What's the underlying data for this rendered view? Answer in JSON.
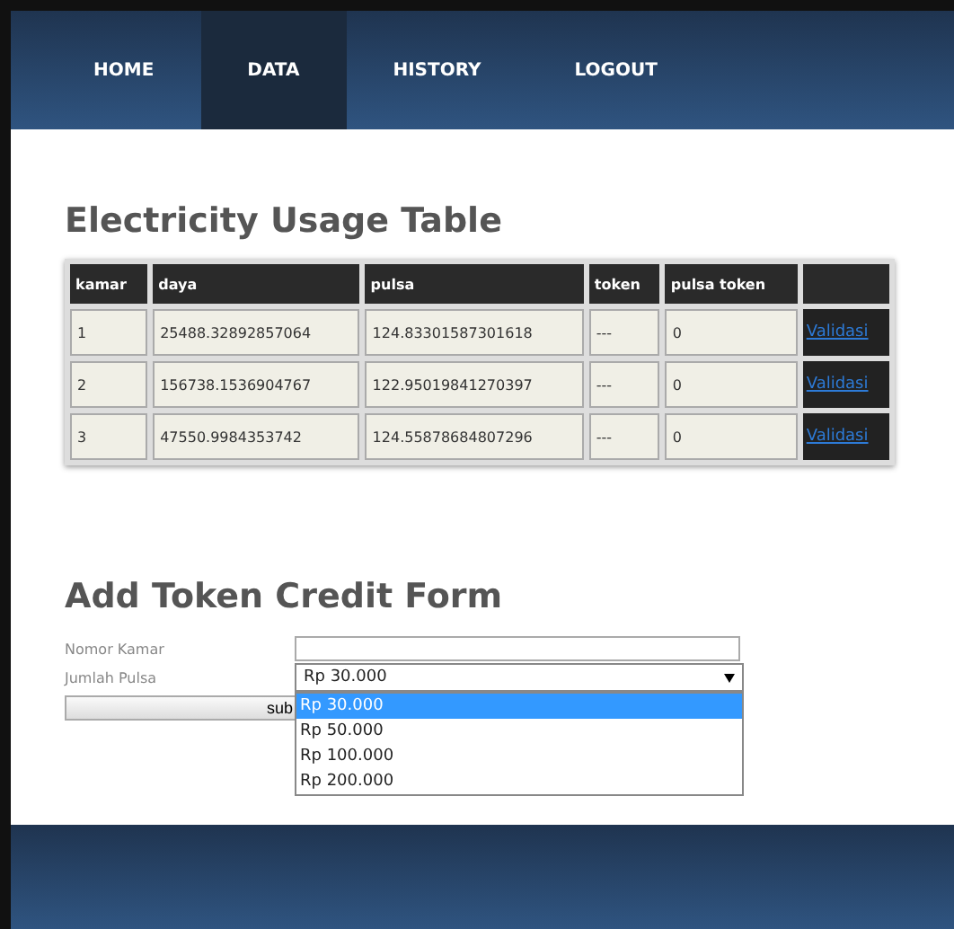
{
  "nav": [
    {
      "label": "HOME",
      "selected": false
    },
    {
      "label": "DATA",
      "selected": true
    },
    {
      "label": "HISTORY",
      "selected": false
    },
    {
      "label": "LOGOUT",
      "selected": false
    }
  ],
  "table": {
    "title": "Electricity Usage Table",
    "columns": [
      "kamar",
      "daya",
      "pulsa",
      "token",
      "pulsa token",
      ""
    ],
    "rows": [
      {
        "cells": [
          "1",
          "25488.32892857064",
          "124.83301587301618",
          "---",
          "0"
        ],
        "action": "Validasi"
      },
      {
        "cells": [
          "2",
          "156738.1536904767",
          "122.95019841270397",
          "---",
          "0"
        ],
        "action": "Validasi"
      },
      {
        "cells": [
          "3",
          "47550.9984353742",
          "124.55878684807296",
          "---",
          "0"
        ],
        "action": "Validasi"
      }
    ]
  },
  "form": {
    "title": "Add Token Credit Form",
    "nomor_label": "Nomor Kamar",
    "jumlah_label": "Jumlah Pulsa",
    "select_value": "Rp 30.000",
    "submit": "sub",
    "options": [
      {
        "label": "Rp 30.000",
        "selected": true
      },
      {
        "label": "Rp 50.000",
        "selected": false
      },
      {
        "label": "Rp 100.000",
        "selected": false
      },
      {
        "label": "Rp 200.000",
        "selected": false
      }
    ]
  }
}
